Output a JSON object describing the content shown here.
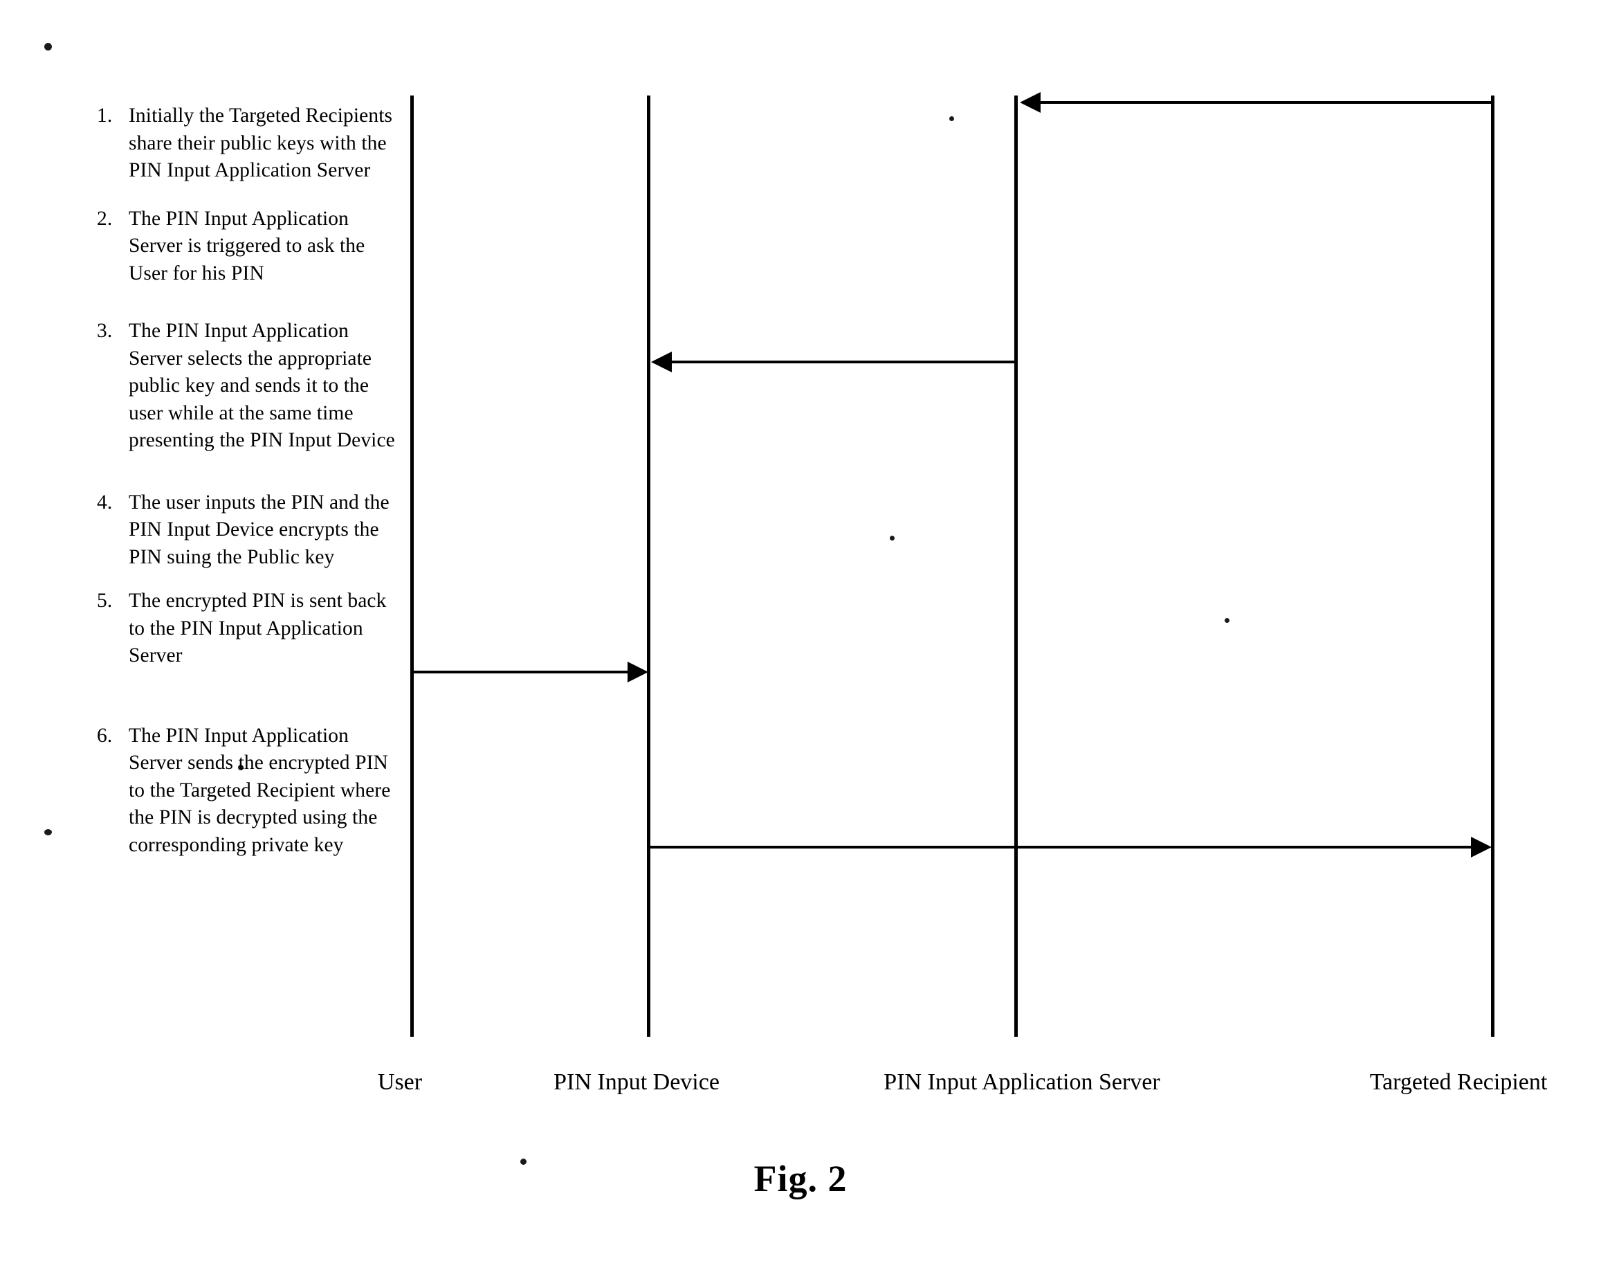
{
  "figure": {
    "caption": "Fig. 2",
    "title": "PIN input sequence diagram"
  },
  "steps": [
    {
      "number": "1.",
      "text": "Initially the Targeted Recipients share their public keys with the PIN Input Application Server"
    },
    {
      "number": "2.",
      "text": "The PIN Input Application Server is triggered to ask the User for his PIN"
    },
    {
      "number": "3.",
      "text": "The PIN Input Application Server selects the appropriate public key and sends it to the user while at the same time presenting the PIN Input Device"
    },
    {
      "number": "4.",
      "text": "The user inputs the PIN and the PIN Input Device encrypts the PIN suing the Public key"
    },
    {
      "number": "5.",
      "text": "The encrypted PIN is sent back to the PIN Input Application Server"
    },
    {
      "number": "6.",
      "text": "The PIN Input Application Server sends the encrypted PIN to the Targeted Recipient where the PIN is decrypted using the corresponding private key"
    }
  ],
  "actors": [
    {
      "id": "user",
      "label": "User"
    },
    {
      "id": "pin-input-device",
      "label": "PIN Input Device"
    },
    {
      "id": "pin-input-application-server",
      "label": "PIN Input Application Server"
    },
    {
      "id": "targeted-recipient",
      "label": "Targeted Recipient"
    }
  ],
  "messages": [
    {
      "id": "message-1",
      "step": "1",
      "from": "targeted-recipient",
      "to": "pin-input-application-server",
      "direction": "left"
    },
    {
      "id": "message-3",
      "step": "3",
      "from": "pin-input-application-server",
      "to": "pin-input-device",
      "direction": "left"
    },
    {
      "id": "message-5",
      "step": "5",
      "from": "user",
      "to": "pin-input-device",
      "direction": "right"
    },
    {
      "id": "message-6",
      "step": "6",
      "from": "pin-input-device",
      "to": "targeted-recipient",
      "direction": "right"
    }
  ],
  "colors": {
    "ink": "#000000",
    "paper": "#ffffff"
  }
}
